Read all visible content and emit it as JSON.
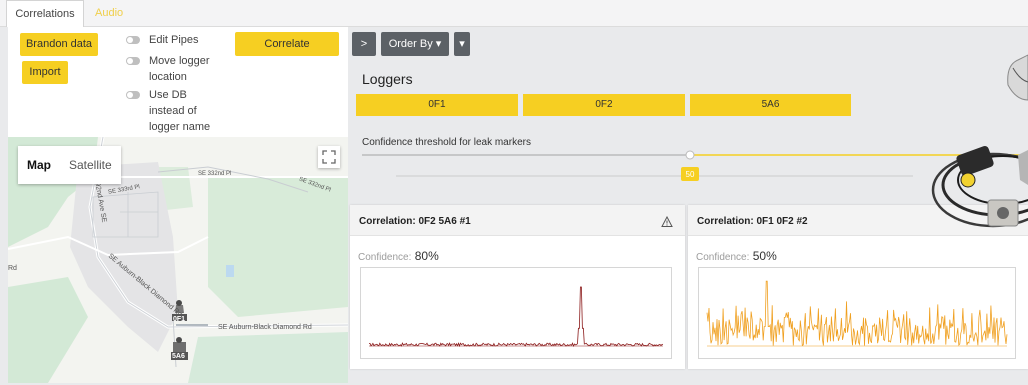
{
  "tabs": [
    {
      "label": "Correlations"
    },
    {
      "label": "Audio"
    }
  ],
  "panel": {
    "brandon_label": "Brandon data",
    "import_label": "Import",
    "correlate_label": "Correlate",
    "toggles": [
      {
        "label": "Edit Pipes",
        "on": false
      },
      {
        "label": "Move logger location",
        "on": false
      },
      {
        "label": "Use DB instead of logger name",
        "on": false
      }
    ]
  },
  "map": {
    "map_tab": "Map",
    "satellite_tab": "Satellite",
    "road_labels": [
      "SE 332nd Pl",
      "SE 332nd Pl",
      "SE 333rd Pl",
      "192nd Ave SE",
      "SE Auburn-Black Diamond Rd",
      "SE Auburn-Black Diamond Rd",
      "Rd"
    ],
    "markers": [
      {
        "label": "0F1"
      },
      {
        "label": "5A6"
      }
    ]
  },
  "toolbar": {
    "next_glyph": ">",
    "order_by_label": "Order By ▾",
    "dropdown_glyph": "▾"
  },
  "loggers": {
    "title": "Loggers",
    "items": [
      {
        "label": "0F1"
      },
      {
        "label": "0F2"
      },
      {
        "label": "5A6"
      }
    ]
  },
  "threshold": {
    "label": "Confidence threshold for leak markers",
    "value": 50,
    "value_text": "50"
  },
  "correlations": [
    {
      "title": "Correlation: 0F2 5A6 #1",
      "confidence_label": "Confidence:",
      "confidence": "80%",
      "warning_icon": "warning-icon",
      "color": "#8b1a1a",
      "trace": {
        "type": "spike",
        "spike_at": 0.72,
        "spike_height": 0.82,
        "noise": 0.04
      }
    },
    {
      "title": "Correlation: 0F1 0F2 #2",
      "confidence_label": "Confidence:",
      "confidence": "50%",
      "color": "#f0a020",
      "trace": {
        "type": "noise",
        "spike_at": 0.2,
        "spike_height": 0.9,
        "noise": 0.4
      }
    }
  ],
  "colors": {
    "accent": "#f6cf22",
    "dark_button": "#5c6166",
    "trace1": "#8b1a1a",
    "trace2": "#f0a020"
  }
}
